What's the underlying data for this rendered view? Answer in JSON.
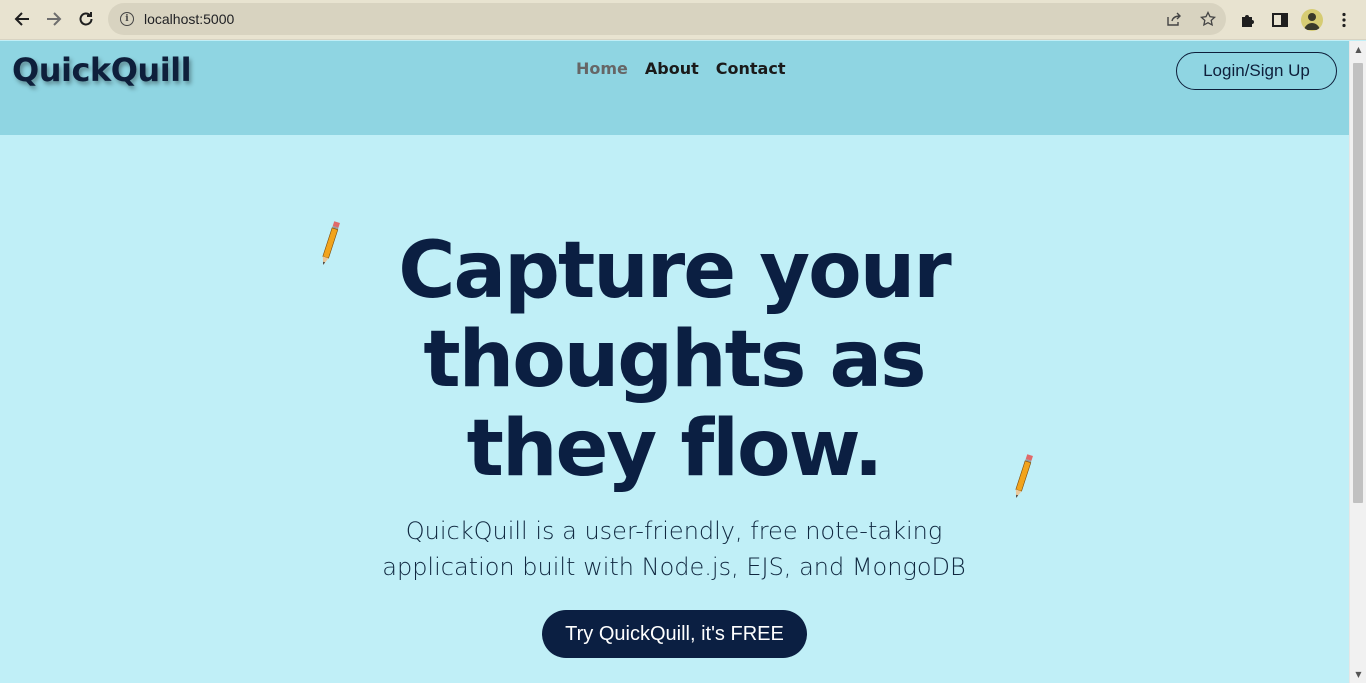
{
  "browser": {
    "url": "localhost:5000",
    "icons": {
      "back": "back-arrow-icon",
      "forward": "forward-arrow-icon",
      "reload": "reload-icon",
      "info": "site-info-icon",
      "share": "share-icon",
      "bookmark": "star-icon",
      "extensions": "puzzle-icon",
      "sidepanel": "side-panel-icon",
      "profile": "profile-avatar-icon",
      "menu": "kebab-menu-icon"
    }
  },
  "header": {
    "logo": "QuickQuill",
    "nav": [
      {
        "label": "Home"
      },
      {
        "label": "About"
      },
      {
        "label": "Contact"
      }
    ],
    "login_label": "Login/Sign Up"
  },
  "hero": {
    "headline_line1": "Capture your",
    "headline_line2": "thoughts as",
    "headline_line3": "they flow.",
    "subtitle_line1": "QuickQuill is a user-friendly, free note-taking",
    "subtitle_line2": "application built with Node.js, EJS, and MongoDB",
    "cta_label": "Try QuickQuill, it's FREE"
  },
  "colors": {
    "header_bg": "#8fd5e2",
    "page_bg": "#c0eff7",
    "text_dark": "#0b1f42",
    "nav_active": "#666666"
  }
}
